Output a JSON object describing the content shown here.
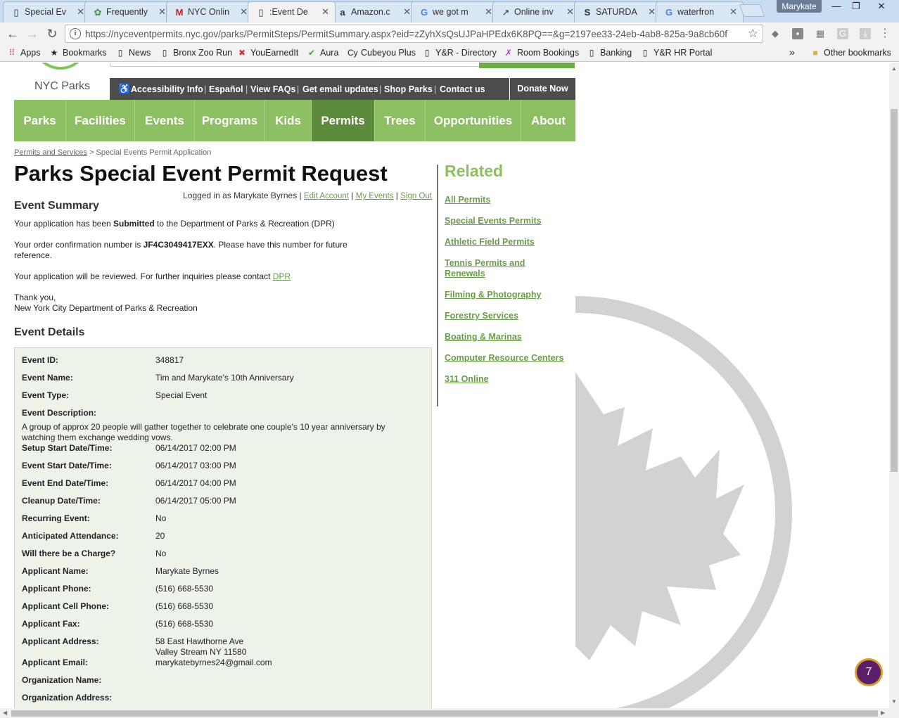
{
  "browser": {
    "tabs": [
      {
        "title": "Special Ev",
        "icon": "page-icon"
      },
      {
        "title": "Frequently",
        "icon": "nycparks-icon"
      },
      {
        "title": "NYC Onlin",
        "icon": "gmail-icon"
      },
      {
        "title": ":Event De",
        "icon": "page-icon",
        "active": true
      },
      {
        "title": "Amazon.c",
        "icon": "amazon-icon"
      },
      {
        "title": "we got m",
        "icon": "google-icon"
      },
      {
        "title": "Online inv",
        "icon": "invite-icon"
      },
      {
        "title": "SATURDA",
        "icon": "s-icon"
      },
      {
        "title": "waterfron",
        "icon": "google-icon"
      }
    ],
    "profile_name": "Marykate",
    "url": "https://nyceventpermits.nyc.gov/parks/PermitSteps/PermitSummary.aspx?eid=zZyhXsQsUJPaHPEdx6K8PQ==&g=2197ee33-24eb-4ab8-825a-9a8cb60f",
    "bookmarks": [
      {
        "label": "Apps",
        "icon": "apps-icon"
      },
      {
        "label": "Bookmarks",
        "icon": "star-icon"
      },
      {
        "label": "News",
        "icon": "page-icon"
      },
      {
        "label": "Bronx Zoo Run",
        "icon": "page-icon"
      },
      {
        "label": "YouEarnedIt",
        "icon": "youearnedit-icon"
      },
      {
        "label": "Aura",
        "icon": "aura-icon"
      },
      {
        "label": "Cubeyou Plus",
        "icon": "cubeyou-icon"
      },
      {
        "label": "Y&R - Directory",
        "icon": "page-icon"
      },
      {
        "label": "Room Bookings",
        "icon": "room-icon"
      },
      {
        "label": "Banking",
        "icon": "page-icon"
      },
      {
        "label": "Y&R HR Portal",
        "icon": "page-icon"
      }
    ],
    "bookmarks_overflow": "»",
    "other_bookmarks": "Other bookmarks"
  },
  "site": {
    "logo_text": "NYC Parks",
    "util_links": [
      "Accessibility Info",
      "Español",
      "View FAQs",
      "Get email updates",
      "Shop Parks",
      "Contact us"
    ],
    "donate": "Donate Now",
    "nav": [
      "Parks",
      "Facilities",
      "Events",
      "Programs",
      "Kids",
      "Permits",
      "Trees",
      "Opportunities",
      "About"
    ],
    "active_nav": "Permits",
    "accent_green": "#8cc063",
    "active_green": "#5c8b3c"
  },
  "breadcrumb": {
    "link": "Permits and Services",
    "separator": ">",
    "current": "Special Events Permit Application"
  },
  "page": {
    "title": "Parks Special Event Permit Request",
    "logged_in_prefix": "Logged in as Marykate Byrnes |",
    "edit_account": "Edit Account",
    "my_events": "My Events",
    "sign_out": "Sign Out",
    "pipe": "|"
  },
  "summary": {
    "heading": "Event Summary",
    "line1_pre": "Your application has been ",
    "line1_bold": "Submitted",
    "line1_post": " to the Department of Parks & Recreation (DPR)",
    "line2_pre": "Your order confirmation number is ",
    "line2_bold": "JF4C3049417EXX",
    "line2_post": ". Please have this number for future reference.",
    "line3_pre": "Your application will be reviewed. For further inquiries please contact ",
    "line3_link": "DPR",
    "thanks": "Thank you,",
    "signoff": "New York City Department of Parks & Recreation"
  },
  "details": {
    "heading": "Event Details",
    "rows": [
      {
        "label": "Event ID:",
        "value": "348817"
      },
      {
        "label": "Event Name:",
        "value": "Tim and Marykate's 10th Anniversary"
      },
      {
        "label": "Event Type:",
        "value": "Special Event"
      },
      {
        "label": "Event Description:",
        "value": ""
      },
      {
        "label": "Setup Start Date/Time:",
        "value": "06/14/2017 02:00 PM"
      },
      {
        "label": "Event Start Date/Time:",
        "value": "06/14/2017 03:00 PM"
      },
      {
        "label": "Event End Date/Time:",
        "value": "06/14/2017 04:00 PM"
      },
      {
        "label": "Cleanup Date/Time:",
        "value": "06/14/2017 05:00 PM"
      },
      {
        "label": "Recurring Event:",
        "value": "No"
      },
      {
        "label": "Anticipated Attendance:",
        "value": "20"
      },
      {
        "label": "Will there be a Charge?",
        "value": "No"
      },
      {
        "label": "Applicant Name:",
        "value": "Marykate Byrnes"
      },
      {
        "label": "Applicant Phone:",
        "value": "(516) 668-5530"
      },
      {
        "label": "Applicant Cell Phone:",
        "value": "(516) 668-5530"
      },
      {
        "label": "Applicant Fax:",
        "value": "(516) 668-5530"
      },
      {
        "label": "Applicant Address:",
        "value": "58 East Hawthorne Ave",
        "value2": "Valley Stream NY 11580"
      },
      {
        "label": "Applicant Email:",
        "value": "marykatebyrnes24@gmail.com"
      },
      {
        "label": "Organization Name:",
        "value": ""
      },
      {
        "label": "Organization Address:",
        "value": ""
      }
    ],
    "description": "A group of approx 20 people will gather together to celebrate one couple's 10 year anniversary by watching them exchange wedding vows."
  },
  "related": {
    "title": "Related",
    "links": [
      "All Permits",
      "Special Events Permits",
      "Athletic Field Permits",
      "Tennis Permits and Renewals",
      "Filming & Photography",
      "Forestry Services",
      "Boating & Marinas",
      "Computer Resource Centers",
      "311 Online"
    ]
  },
  "help_badge": "7"
}
